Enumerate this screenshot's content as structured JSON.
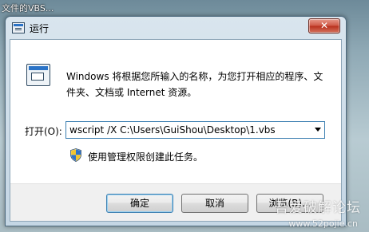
{
  "background": {
    "window_text": "文件的VBS...",
    "watermark_title": "吾爱破解论坛",
    "watermark_url": "www.52pojie.cn"
  },
  "dialog": {
    "title": "运行",
    "close_label": "✕",
    "description": "Windows 将根据您所输入的名称，为您打开相应的程序、文件夹、文档或 Internet 资源。",
    "open_label": "打开(O):",
    "open_value": "wscript /X C:\\Users\\GuiShou\\Desktop\\1.vbs",
    "admin_note": "使用管理权限创建此任务。",
    "buttons": {
      "ok": "确定",
      "cancel": "取消",
      "browse": "浏览(B)..."
    }
  },
  "icons": {
    "title": "run-icon",
    "main": "run-icon",
    "shield": "uac-shield-icon",
    "dropdown": "chevron-down-icon",
    "close": "close-icon"
  },
  "colors": {
    "accent": "#3c7fb1",
    "close_button": "#c7412d",
    "desktop": "#8fa9b5"
  }
}
